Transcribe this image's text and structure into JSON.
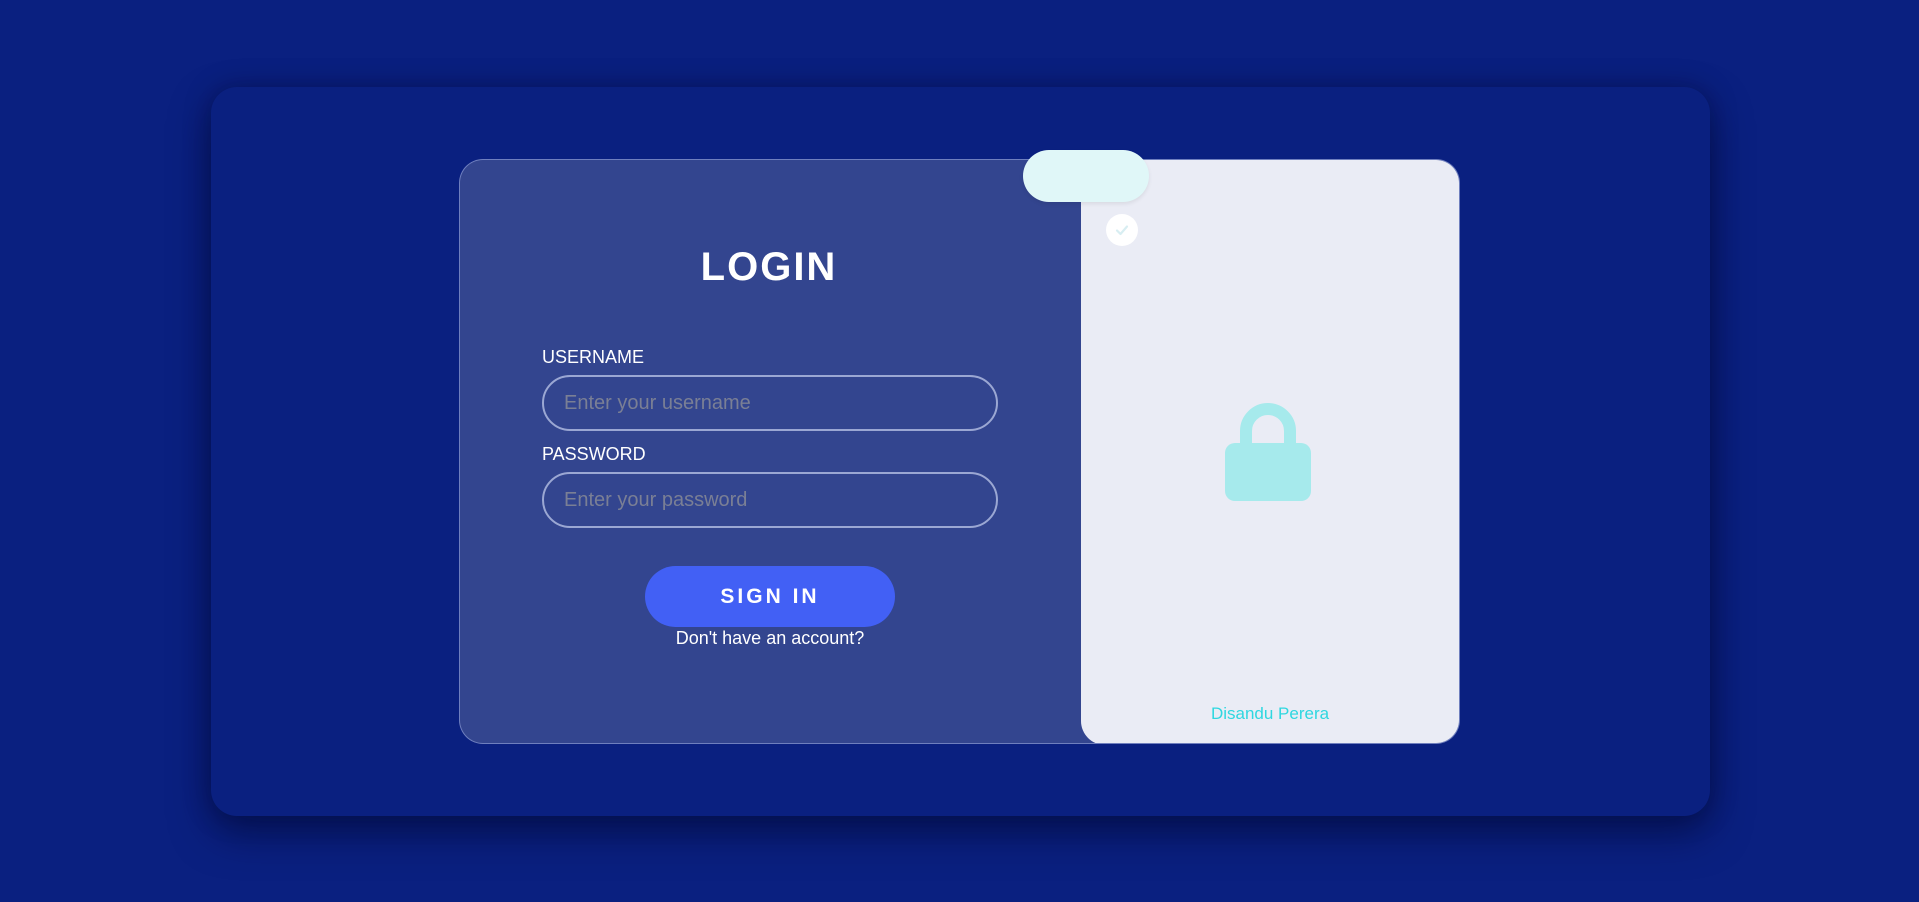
{
  "login": {
    "title": "LOGIN",
    "username_label": "USERNAME",
    "username_placeholder": "Enter your username",
    "password_label": "PASSWORD",
    "password_placeholder": "Enter your password",
    "signin_label": "SIGN IN",
    "signup_prompt": "Don't have an account?"
  },
  "side_panel": {
    "icon": "lock-icon",
    "status_icon": "check-icon",
    "author": "Disandu Perera"
  },
  "colors": {
    "background": "#0a2080",
    "card": "#33458f",
    "side_panel": "#eaecf5",
    "accent_button": "#4260f5",
    "lock": "#a6eaec",
    "author_text": "#2fd7e0"
  }
}
